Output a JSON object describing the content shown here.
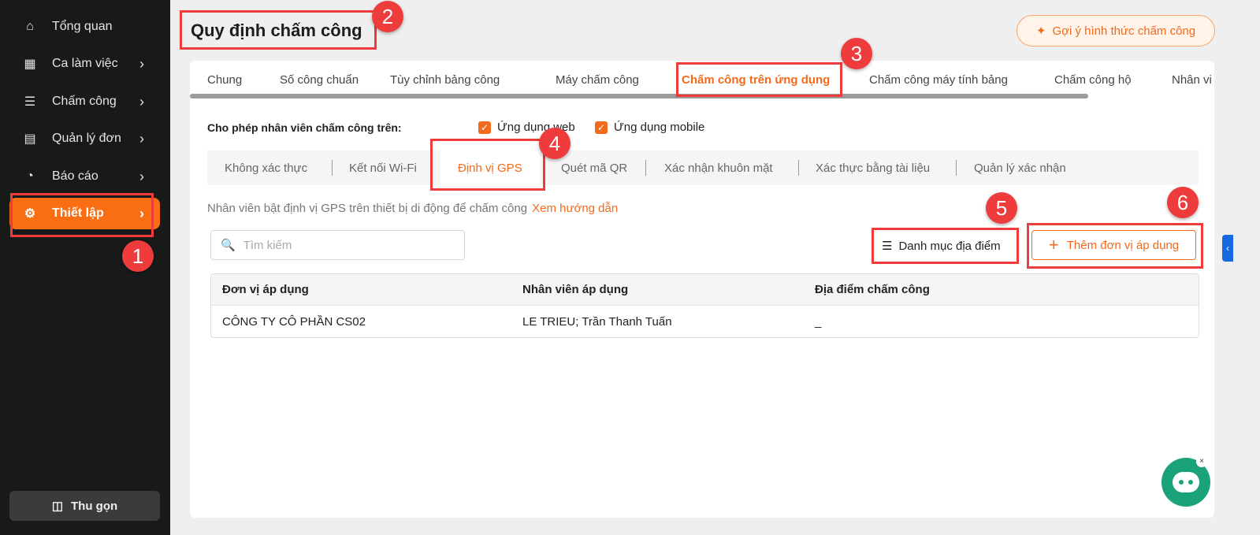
{
  "sidebar": {
    "items": [
      {
        "label": "Tổng quan",
        "icon": "home-icon"
      },
      {
        "label": "Ca làm việc",
        "icon": "calendar-icon"
      },
      {
        "label": "Chấm công",
        "icon": "checklist-icon"
      },
      {
        "label": "Quản lý đơn",
        "icon": "document-icon"
      },
      {
        "label": "Báo cáo",
        "icon": "pie-chart-icon"
      },
      {
        "label": "Thiết lập",
        "icon": "gear-icon"
      }
    ],
    "collapse": "Thu gọn"
  },
  "header": {
    "title": "Quy định chấm công",
    "suggest": "Gợi ý hình thức chấm công"
  },
  "tabs": [
    "Chung",
    "Số công chuẩn",
    "Tùy chỉnh bảng công",
    "Máy chấm công",
    "Chấm công trên ứng dụng",
    "Chấm công máy tính bảng",
    "Chấm công hộ",
    "Nhân vi"
  ],
  "allow": {
    "label": "Cho phép nhân viên chấm công trên:",
    "options": [
      "Ứng dụng web",
      "Ứng dụng mobile"
    ]
  },
  "subtabs": [
    "Không xác thực",
    "Kết nối Wi-Fi",
    "Định vị GPS",
    "Quét mã QR",
    "Xác nhận khuôn mặt",
    "Xác thực bằng tài liệu",
    "Quản lý xác nhận"
  ],
  "desc": {
    "text": "Nhân viên bật định vị GPS trên thiết bị di động để chấm công",
    "link": "Xem hướng dẫn"
  },
  "search": {
    "placeholder": "Tìm kiếm"
  },
  "buttons": {
    "locations": "Danh mục địa điểm",
    "add": "Thêm đơn vị áp dụng"
  },
  "table": {
    "headers": [
      "Đơn vị áp dụng",
      "Nhân viên áp dụng",
      "Địa điểm chấm công"
    ],
    "rows": [
      [
        "CÔNG TY CÔ PHẦN CS02",
        "LE TRIEU; Trần Thanh Tuấn",
        "_"
      ]
    ]
  },
  "badges": [
    "1",
    "2",
    "3",
    "4",
    "5",
    "6"
  ]
}
